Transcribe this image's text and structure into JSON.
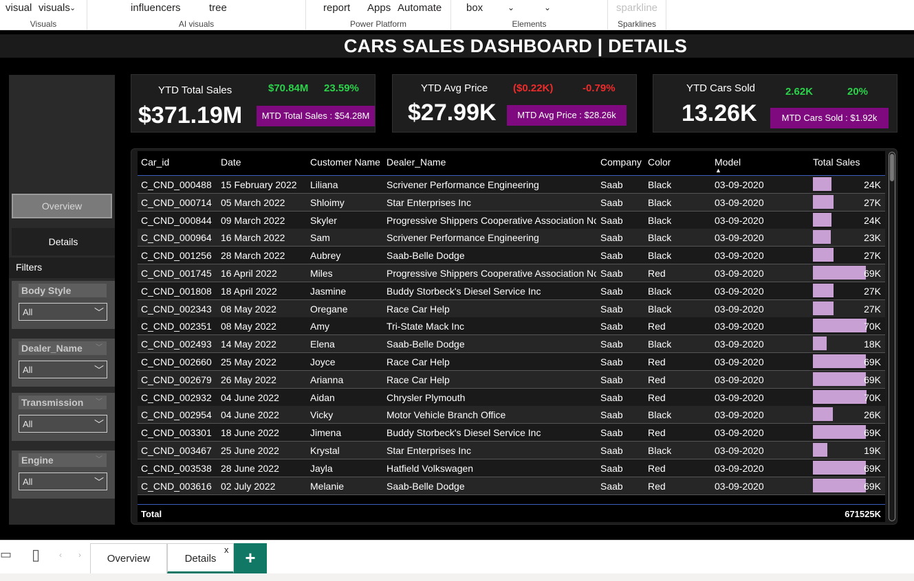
{
  "ribbon": {
    "visuals": {
      "items": [
        "visual",
        "visuals"
      ],
      "label": "Visuals"
    },
    "ai": {
      "items": [
        "influencers",
        "tree"
      ],
      "label": "AI visuals"
    },
    "power": {
      "items": [
        "report",
        "Apps",
        "Automate"
      ],
      "label": "Power Platform"
    },
    "elements": {
      "items": [
        "box"
      ],
      "label": "Elements"
    },
    "sparklines": {
      "items": [
        "sparkline"
      ],
      "label": "Sparklines"
    }
  },
  "page_title": "CARS SALES DASHBOARD | DETAILS",
  "nav": {
    "overview": "Overview",
    "details": "Details",
    "filters": "Filters"
  },
  "slicers": [
    {
      "title": "Body Style",
      "value": "All"
    },
    {
      "title": "Dealer_Name",
      "value": "All"
    },
    {
      "title": "Transmission",
      "value": "All"
    },
    {
      "title": "Engine",
      "value": "All"
    }
  ],
  "kpis": [
    {
      "label": "YTD Total Sales",
      "value": "$371.19M",
      "delta1": "$70.84M",
      "delta2": "23.59%",
      "mtd": "MTD Total Sales : $54.28M",
      "delta_color": "green"
    },
    {
      "label": "YTD Avg Price",
      "value": "$27.99K",
      "delta1": "($0.22K)",
      "delta2": "-0.79%",
      "mtd": "MTD Avg Price : $28.26k",
      "delta_color": "red"
    },
    {
      "label": "YTD Cars Sold",
      "value": "13.26K",
      "delta1": "2.62K",
      "delta2": "20%",
      "mtd": "MTD Cars Sold : $1.92k",
      "delta_color": "green"
    }
  ],
  "table": {
    "columns": [
      "Car_id",
      "Date",
      "Customer Name",
      "Dealer_Name",
      "Company",
      "Color",
      "Model",
      "Total Sales"
    ],
    "rows": [
      [
        "C_CND_000488",
        "15 February 2022",
        "Liliana",
        "Scrivener Performance Engineering",
        "Saab",
        "Black",
        "03-09-2020",
        "24K",
        24
      ],
      [
        "C_CND_000714",
        "05 March 2022",
        "Shloimy",
        "Star Enterprises Inc",
        "Saab",
        "Black",
        "03-09-2020",
        "27K",
        27
      ],
      [
        "C_CND_000844",
        "09 March 2022",
        "Skyler",
        "Progressive Shippers Cooperative Association No",
        "Saab",
        "Black",
        "03-09-2020",
        "24K",
        24
      ],
      [
        "C_CND_000964",
        "16 March 2022",
        "Sam",
        "Scrivener Performance Engineering",
        "Saab",
        "Black",
        "03-09-2020",
        "23K",
        23
      ],
      [
        "C_CND_001256",
        "28 March 2022",
        "Aubrey",
        "Saab-Belle Dodge",
        "Saab",
        "Black",
        "03-09-2020",
        "27K",
        27
      ],
      [
        "C_CND_001745",
        "16 April 2022",
        "Miles",
        "Progressive Shippers Cooperative Association No",
        "Saab",
        "Red",
        "03-09-2020",
        "69K",
        69
      ],
      [
        "C_CND_001808",
        "18 April 2022",
        "Jasmine",
        "Buddy Storbeck's Diesel Service Inc",
        "Saab",
        "Black",
        "03-09-2020",
        "27K",
        27
      ],
      [
        "C_CND_002343",
        "08 May 2022",
        "Oregane",
        "Race Car Help",
        "Saab",
        "Black",
        "03-09-2020",
        "27K",
        27
      ],
      [
        "C_CND_002351",
        "08 May 2022",
        "Amy",
        "Tri-State Mack Inc",
        "Saab",
        "Red",
        "03-09-2020",
        "70K",
        70
      ],
      [
        "C_CND_002493",
        "14 May 2022",
        "Elena",
        "Saab-Belle Dodge",
        "Saab",
        "Black",
        "03-09-2020",
        "18K",
        18
      ],
      [
        "C_CND_002660",
        "25 May 2022",
        "Joyce",
        "Race Car Help",
        "Saab",
        "Red",
        "03-09-2020",
        "69K",
        69
      ],
      [
        "C_CND_002679",
        "26 May 2022",
        "Arianna",
        "Race Car Help",
        "Saab",
        "Red",
        "03-09-2020",
        "69K",
        69
      ],
      [
        "C_CND_002932",
        "04 June 2022",
        "Aidan",
        "Chrysler Plymouth",
        "Saab",
        "Red",
        "03-09-2020",
        "70K",
        70
      ],
      [
        "C_CND_002954",
        "04 June 2022",
        "Vicky",
        "Motor Vehicle Branch Office",
        "Saab",
        "Black",
        "03-09-2020",
        "26K",
        26
      ],
      [
        "C_CND_003301",
        "18 June 2022",
        "Jimena",
        "Buddy Storbeck's Diesel Service Inc",
        "Saab",
        "Red",
        "03-09-2020",
        "69K",
        69
      ],
      [
        "C_CND_003467",
        "25 June 2022",
        "Krystal",
        "Star Enterprises Inc",
        "Saab",
        "Black",
        "03-09-2020",
        "19K",
        19
      ],
      [
        "C_CND_003538",
        "28 June 2022",
        "Jayla",
        "Hatfield Volkswagen",
        "Saab",
        "Red",
        "03-09-2020",
        "69K",
        69
      ],
      [
        "C_CND_003616",
        "02 July 2022",
        "Melanie",
        "Saab-Belle Dodge",
        "Saab",
        "Red",
        "03-09-2020",
        "69K",
        69
      ]
    ],
    "total_label": "Total",
    "total_value": "671525K"
  },
  "tabs": {
    "overview": "Overview",
    "details": "Details",
    "close": "x",
    "add": "+"
  },
  "colors": {
    "bar": "#c9a0d4",
    "mtd_bg": "#7f0a7f",
    "green": "#2bd24a",
    "red": "#ee2b2b",
    "tab_accent": "#117865"
  }
}
